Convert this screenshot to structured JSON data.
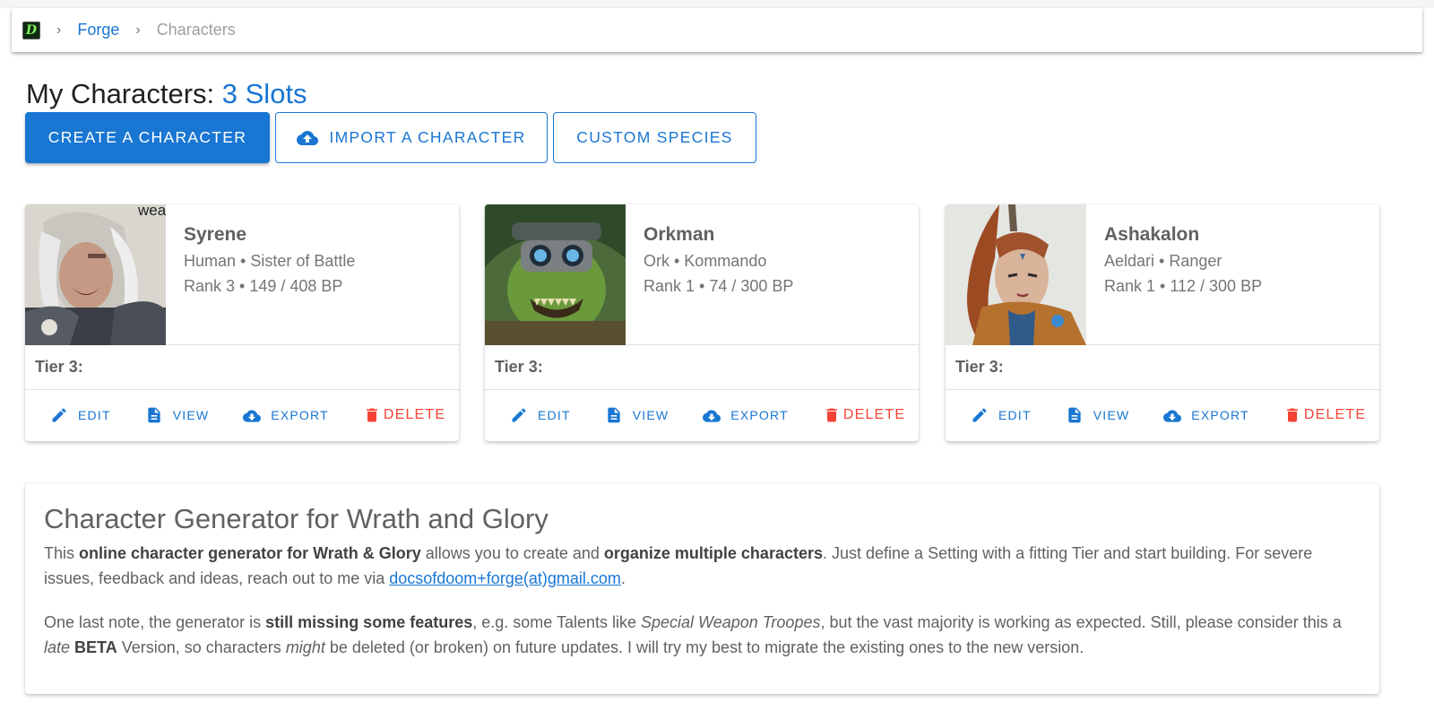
{
  "breadcrumb": {
    "logo_letter": "D",
    "items": [
      "Forge",
      "Characters"
    ]
  },
  "header": {
    "title_prefix": "My Characters: ",
    "slots": "3 Slots"
  },
  "actions": {
    "create": "CREATE A CHARACTER",
    "import": "IMPORT A CHARACTER",
    "custom_species": "CUSTOM SPECIES"
  },
  "card_actions": {
    "edit": "EDIT",
    "view": "VIEW",
    "export": "EXPORT",
    "delete": "DELETE"
  },
  "characters": [
    {
      "name": "Syrene",
      "subtitle": "Human • Sister of Battle",
      "rank": "Rank 3 • 149 / 408 BP",
      "tier": "Tier 3:",
      "portrait_text": "wea"
    },
    {
      "name": "Orkman",
      "subtitle": "Ork • Kommando",
      "rank": "Rank 1 • 74 / 300 BP",
      "tier": "Tier 3:"
    },
    {
      "name": "Ashakalon",
      "subtitle": "Aeldari • Ranger",
      "rank": "Rank 1 • 112 / 300 BP",
      "tier": "Tier 3:"
    }
  ],
  "info": {
    "title": "Character Generator for Wrath and Glory",
    "p1": {
      "t1": "This ",
      "b1": "online character generator for Wrath & Glory",
      "t2": " allows you to create and ",
      "b2": "organize multiple characters",
      "t3": ". Just define a Setting with a fitting Tier and start building. For severe issues, feedback and ideas, reach out to me via ",
      "email": "docsofdoom+forge(at)gmail.com",
      "t4": "."
    },
    "p2": {
      "t1": "One last note, the generator is ",
      "b1": "still missing some features",
      "t2": ", e.g. some Talents like ",
      "i1": "Special Weapon Troopes",
      "t3": ", but the vast majority is working as expected. Still, please consider this a ",
      "i2": "late",
      "t4": " ",
      "b2": "BETA",
      "t5": " Version, so characters ",
      "i3": "might",
      "t6": " be deleted (or broken) on future updates. I will try my best to migrate the existing ones to the new version."
    }
  },
  "colors": {
    "primary": "#1976d2",
    "danger": "#f44336"
  },
  "icons": [
    "app-logo-icon",
    "chevron-right-icon",
    "cloud-upload-icon",
    "pencil-icon",
    "document-icon",
    "cloud-download-icon",
    "trash-icon"
  ]
}
